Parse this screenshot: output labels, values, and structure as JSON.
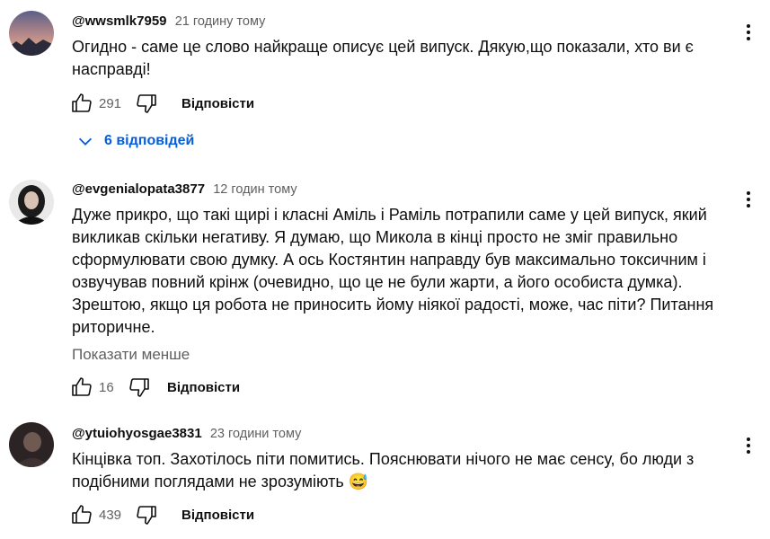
{
  "comments": [
    {
      "author": "@wwsmlk7959",
      "time": "21 годину тому",
      "text": "Огидно - саме це слово найкраще описує цей випуск. Дякую,що показали, хто ви є насправді!",
      "likes": "291",
      "reply_label": "Відповісти",
      "replies_label": "6 відповідей"
    },
    {
      "author": "@evgenialopata3877",
      "time": "12 годин тому",
      "text": "Дуже прикро, що такі щирі і класні Аміль і Раміль потрапили саме у цей випуск, який викликав скільки негативу. Я думаю, що Микола в кінці просто не зміг правильно сформулювати свою думку. А ось Костянтин направду був максимально токсичним і озвучував повний крінж (очевидно, що це не були жарти, а його особиста думка). Зрештою, якщо ця робота не приносить йому ніякої радості, може, час піти? Питання риторичне.",
      "show_less": "Показати менше",
      "likes": "16",
      "reply_label": "Відповісти"
    },
    {
      "author": "@ytuiohyosgae3831",
      "time": "23 години тому",
      "text": "Кінцівка топ. Захотілось піти помитись. Пояснювати нічого не має сенсу, бо люди з подібними поглядами не зрозуміють 😅",
      "likes": "439",
      "reply_label": "Відповісти"
    }
  ],
  "icons": {
    "like": "like-icon",
    "dislike": "dislike-icon",
    "more": "more-vert-icon",
    "expand": "chevron-down-icon"
  },
  "colors": {
    "link_blue": "#065fd4",
    "secondary_text": "#606060"
  }
}
